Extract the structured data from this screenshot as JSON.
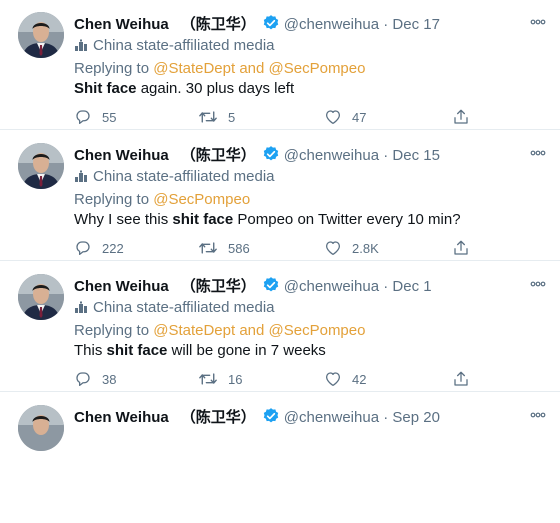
{
  "tweets": [
    {
      "name": "Chen Weihua",
      "name_cjk": "（陈卫华）",
      "handle": "@chenweihua",
      "separator": "·",
      "date": "Dec 17",
      "affiliation": "China state-affiliated media",
      "replying_prefix": "Replying to ",
      "replying_to": "@StateDept and @SecPompeo",
      "text_before": "",
      "text_bold": "Shit face",
      "text_after": " again.  30 plus days left",
      "replies": "55",
      "retweets": "5",
      "likes": "47"
    },
    {
      "name": "Chen Weihua",
      "name_cjk": "（陈卫华）",
      "handle": "@chenweihua",
      "separator": "·",
      "date": "Dec 15",
      "affiliation": "China state-affiliated media",
      "replying_prefix": "Replying to ",
      "replying_to": "@SecPompeo",
      "text_before": "Why I see this ",
      "text_bold": "shit face",
      "text_after": " Pompeo on Twitter every 10 min?",
      "replies": "222",
      "retweets": "586",
      "likes": "2.8K"
    },
    {
      "name": "Chen Weihua",
      "name_cjk": "（陈卫华）",
      "handle": "@chenweihua",
      "separator": "·",
      "date": "Dec 1",
      "affiliation": "China state-affiliated media",
      "replying_prefix": "Replying to ",
      "replying_to": "@StateDept and @SecPompeo",
      "text_before": "This ",
      "text_bold": "shit face",
      "text_after": " will be gone in 7 weeks",
      "replies": "38",
      "retweets": "16",
      "likes": "42"
    },
    {
      "name": "Chen Weihua",
      "name_cjk": "（陈卫华）",
      "handle": "@chenweihua",
      "separator": "·",
      "date": "Sep 20"
    }
  ],
  "icons": {
    "more": "more-icon",
    "reply": "reply-icon",
    "retweet": "retweet-icon",
    "like": "heart-icon",
    "share": "share-icon",
    "verified": "verified-badge-icon",
    "affiliation": "podium-icon"
  },
  "colors": {
    "mention": "#e3a13a",
    "verified": "#1da1f2",
    "muted": "#5b7083",
    "divider": "#e6ecf0"
  }
}
